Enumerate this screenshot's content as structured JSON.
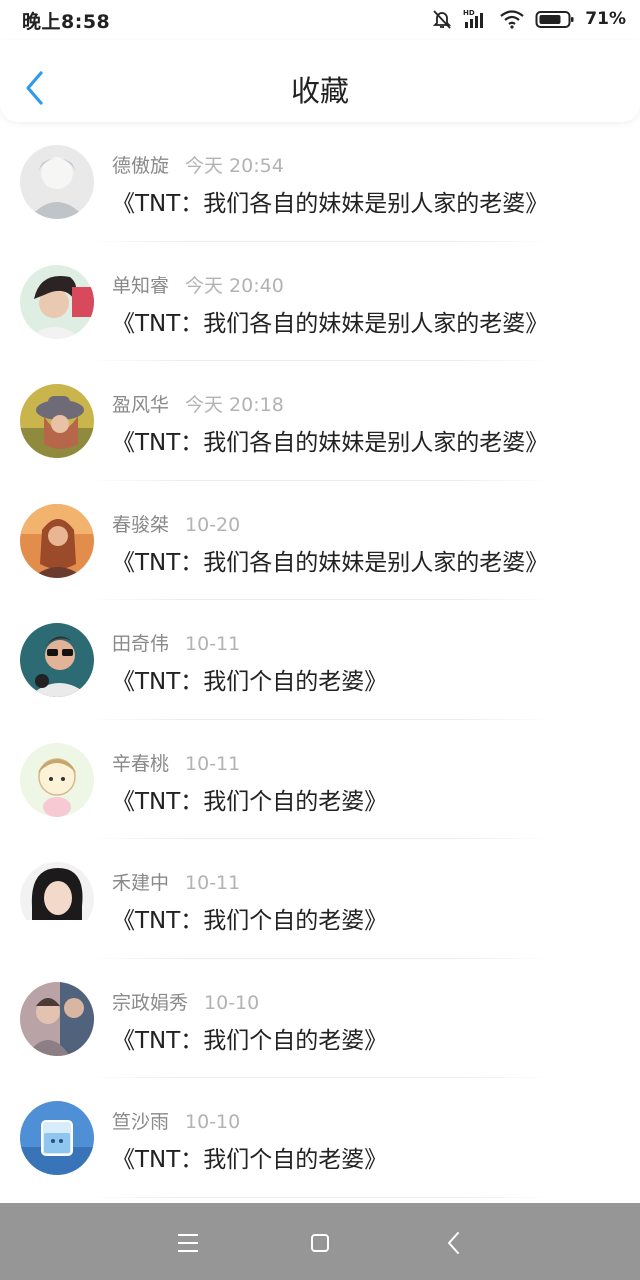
{
  "status_bar": {
    "time": "晚上8:58",
    "network": "HD",
    "battery_percent": "71%"
  },
  "header": {
    "title": "收藏",
    "back_icon": "chevron-left-icon",
    "accent_color": "#2f9be8"
  },
  "favorites": [
    {
      "name": "德傲旋",
      "time": "今天 20:54",
      "title": "《TNT：我们各自的妹妹是别人家的老婆》"
    },
    {
      "name": "单知睿",
      "time": "今天 20:40",
      "title": "《TNT：我们各自的妹妹是别人家的老婆》"
    },
    {
      "name": "盈风华",
      "time": "今天 20:18",
      "title": "《TNT：我们各自的妹妹是别人家的老婆》"
    },
    {
      "name": "春骏桀",
      "time": "10-20",
      "title": "《TNT：我们各自的妹妹是别人家的老婆》"
    },
    {
      "name": "田奇伟",
      "time": "10-11",
      "title": "《TNT：我们个自的老婆》"
    },
    {
      "name": "辛春桃",
      "time": "10-11",
      "title": "《TNT：我们个自的老婆》"
    },
    {
      "name": "禾建中",
      "time": "10-11",
      "title": "《TNT：我们个自的老婆》"
    },
    {
      "name": "宗政娟秀",
      "time": "10-10",
      "title": "《TNT：我们个自的老婆》"
    },
    {
      "name": "笪沙雨",
      "time": "10-10",
      "title": "《TNT：我们个自的老婆》"
    }
  ],
  "nav_bar": {
    "buttons": [
      "menu-icon",
      "home-icon",
      "back-icon"
    ]
  }
}
